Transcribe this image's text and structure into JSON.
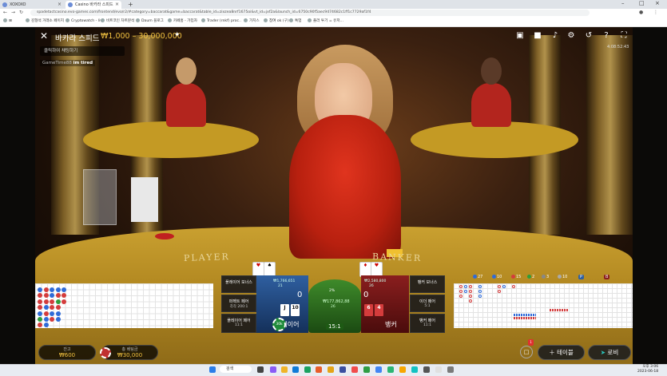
{
  "browser": {
    "tabs": [
      {
        "label": "XOXOXO"
      },
      {
        "label": "Casino 바카라 스피드"
      }
    ],
    "url": "spadetactcasino.evo-games.com/frontend/evo/r2/#category=baccarat&game=baccarat&table_id=zixzea8nrf1675oi&vt_id=jxf2a&launch_id=6750c90f5aec9474682c1ff1c7729af1f4",
    "bookmarks": [
      "김형석 거래소 페이지",
      "Cryptowatch - live",
      "비트코인 차트분석",
      "Daum 블로그",
      "카페홈 - 가입자",
      "Trader (rnkf) proc..",
      "가치스",
      "참여 ok (구)",
      "톡업",
      "플러 투기 = 유저..."
    ]
  },
  "header": {
    "game_title": "바카라 스피드",
    "bet_limit": "₩1,000 – 30,000,000",
    "clock": "4:08:52:43"
  },
  "chat": {
    "placeholder": "클릭하여 채팅하기",
    "messages": [
      {
        "user": "GameTime88",
        "text": "im tired"
      }
    ]
  },
  "table_labels": {
    "player": "PLAYER",
    "banker": "BANKER"
  },
  "stats": {
    "player_wins": "27",
    "banker_wins": "10",
    "ties": "15",
    "player_pairs": "2",
    "banker_pairs": "3",
    "count_a": "10",
    "p_hist": "P",
    "b_hist": "B"
  },
  "betting": {
    "player_bonus": "플레이어 보너스",
    "perfect_pair": "퍼펙트 페어",
    "perfect_pair_odds": "각각 200:1",
    "player_pair": "플레이어 페어",
    "player_pair_odds": "11:1",
    "banker_bonus": "뱅커 보너스",
    "either_pair": "이더 페어",
    "either_pair_odds": "5:1",
    "banker_pair": "뱅커 페어",
    "banker_pair_odds": "11:1",
    "player_label": "플레이어",
    "banker_label": "뱅커",
    "player_score": "0",
    "banker_score": "0",
    "player_total": "₩1,766,651",
    "player_count": "21",
    "tie_percent": "2%",
    "tie_total": "₩177,862,88",
    "tie_count": "26",
    "tie_ratio": "15:1",
    "banker_total": "₩2,580,800",
    "banker_count": "26",
    "player_cards": [
      "J",
      "10"
    ],
    "banker_cards": [
      "6",
      "4"
    ],
    "chip_value": "30k"
  },
  "bottom": {
    "balance_label": "잔고",
    "balance_value": "₩600",
    "total_bet_label": "총 베팅금",
    "total_bet_value": "₩30,000",
    "table_button": "테이블",
    "lobby_button": "로비",
    "notification_count": "1"
  },
  "taskbar": {
    "search": "검색",
    "time": "오후 3:06",
    "date": "2023-06-18"
  },
  "colors": {
    "accent_gold": "#f0c040",
    "player_blue": "#2f5fa0",
    "banker_red": "#8a1e1e",
    "tie_green": "#3e8a2a"
  },
  "icons": [
    "close-icon",
    "chat-icon",
    "video-icon",
    "sound-icon",
    "settings-icon",
    "history-icon",
    "help-icon",
    "fullscreen-icon",
    "pin-icon",
    "plus-icon",
    "arrow-icon"
  ]
}
